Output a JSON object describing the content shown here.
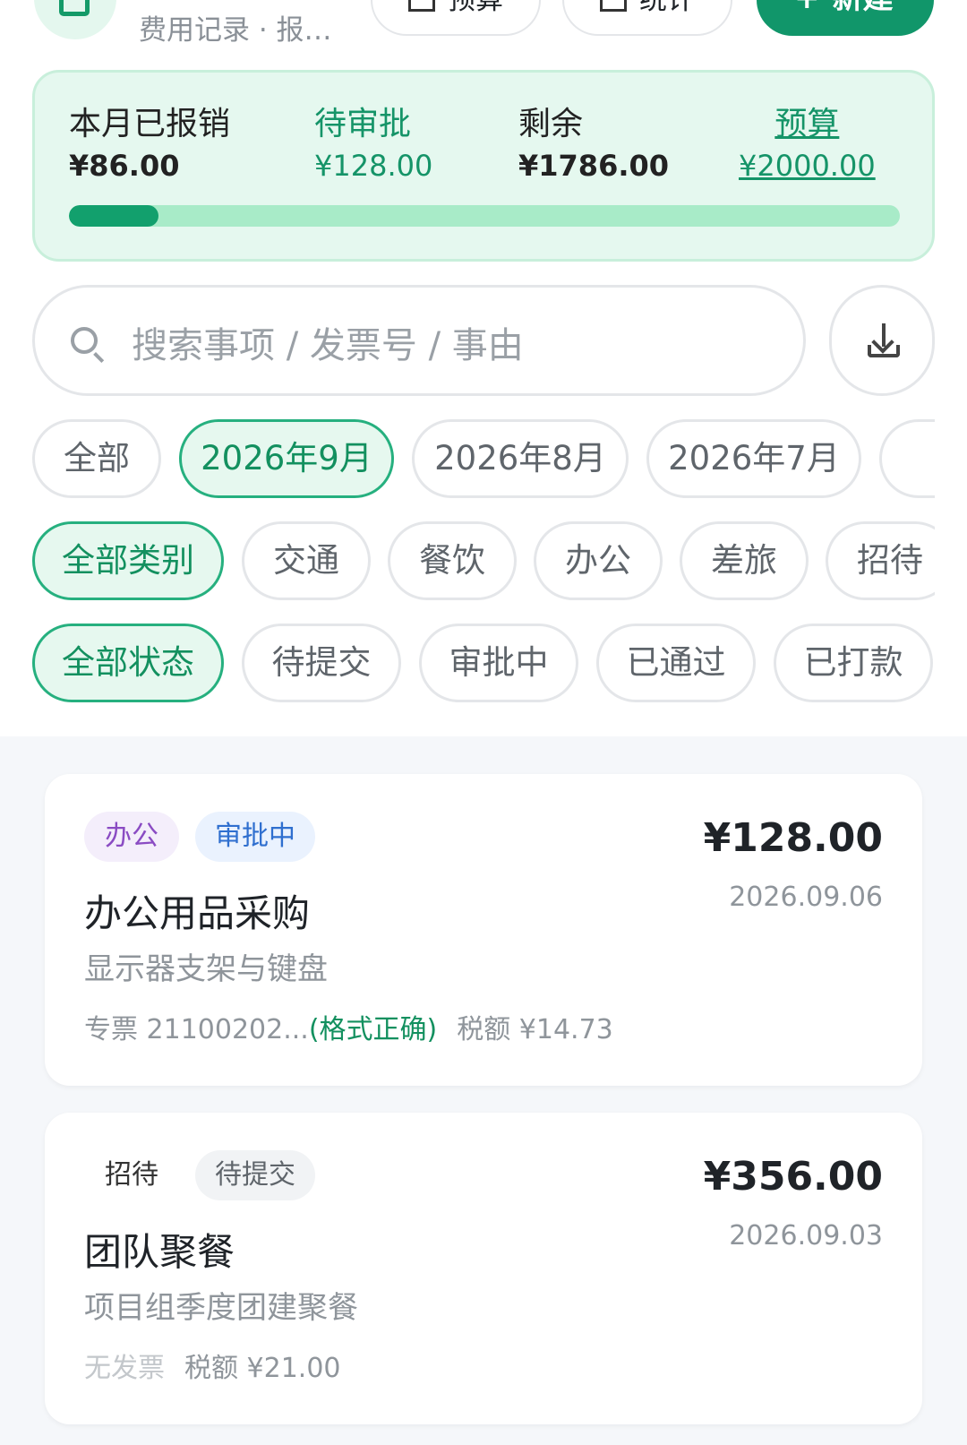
{
  "header": {
    "subtitle": "费用记录 · 报…",
    "buttons": [
      {
        "label": "预算"
      },
      {
        "label": "统计"
      }
    ],
    "new_label": "新建"
  },
  "summary": {
    "reimbursed_label": "本月已报销",
    "reimbursed_value": "¥86.00",
    "pending_label": "待审批",
    "pending_value": "¥128.00",
    "remaining_label": "剩余",
    "remaining_value": "¥1786.00",
    "budget_label": "预算",
    "budget_value": "¥2000.00",
    "progress_fraction": 0.043,
    "colors": {
      "accent": "#11966a",
      "track": "#a8ebc8",
      "card_bg": "#e5f8ef"
    }
  },
  "search": {
    "placeholder": "搜索事项 / 发票号 / 事由",
    "icon": "search-icon",
    "download_icon": "download-icon"
  },
  "filters": {
    "months": [
      "全部",
      "2026年9月",
      "2026年8月",
      "2026年7月"
    ],
    "months_selected": "2026年9月",
    "categories": [
      "全部类别",
      "交通",
      "餐饮",
      "办公",
      "差旅",
      "招待"
    ],
    "categories_selected": "全部类别",
    "statuses": [
      "全部状态",
      "待提交",
      "审批中",
      "已通过",
      "已打款"
    ],
    "statuses_selected": "全部状态"
  },
  "records": [
    {
      "category": "办公",
      "status": "审批中",
      "title": "办公用品采购",
      "description": "显示器支架与键盘",
      "invoice": "专票 21100202...",
      "invoice_note": "(格式正确)",
      "tax": "税额 ¥14.73",
      "amount": "¥128.00",
      "date": "2026.09.06"
    },
    {
      "category": "招待",
      "status": "待提交",
      "title": "团队聚餐",
      "description": "项目组季度团建聚餐",
      "invoice": "无发票",
      "tax": "税额 ¥21.00",
      "amount": "¥356.00",
      "date": "2026.09.03"
    }
  ]
}
